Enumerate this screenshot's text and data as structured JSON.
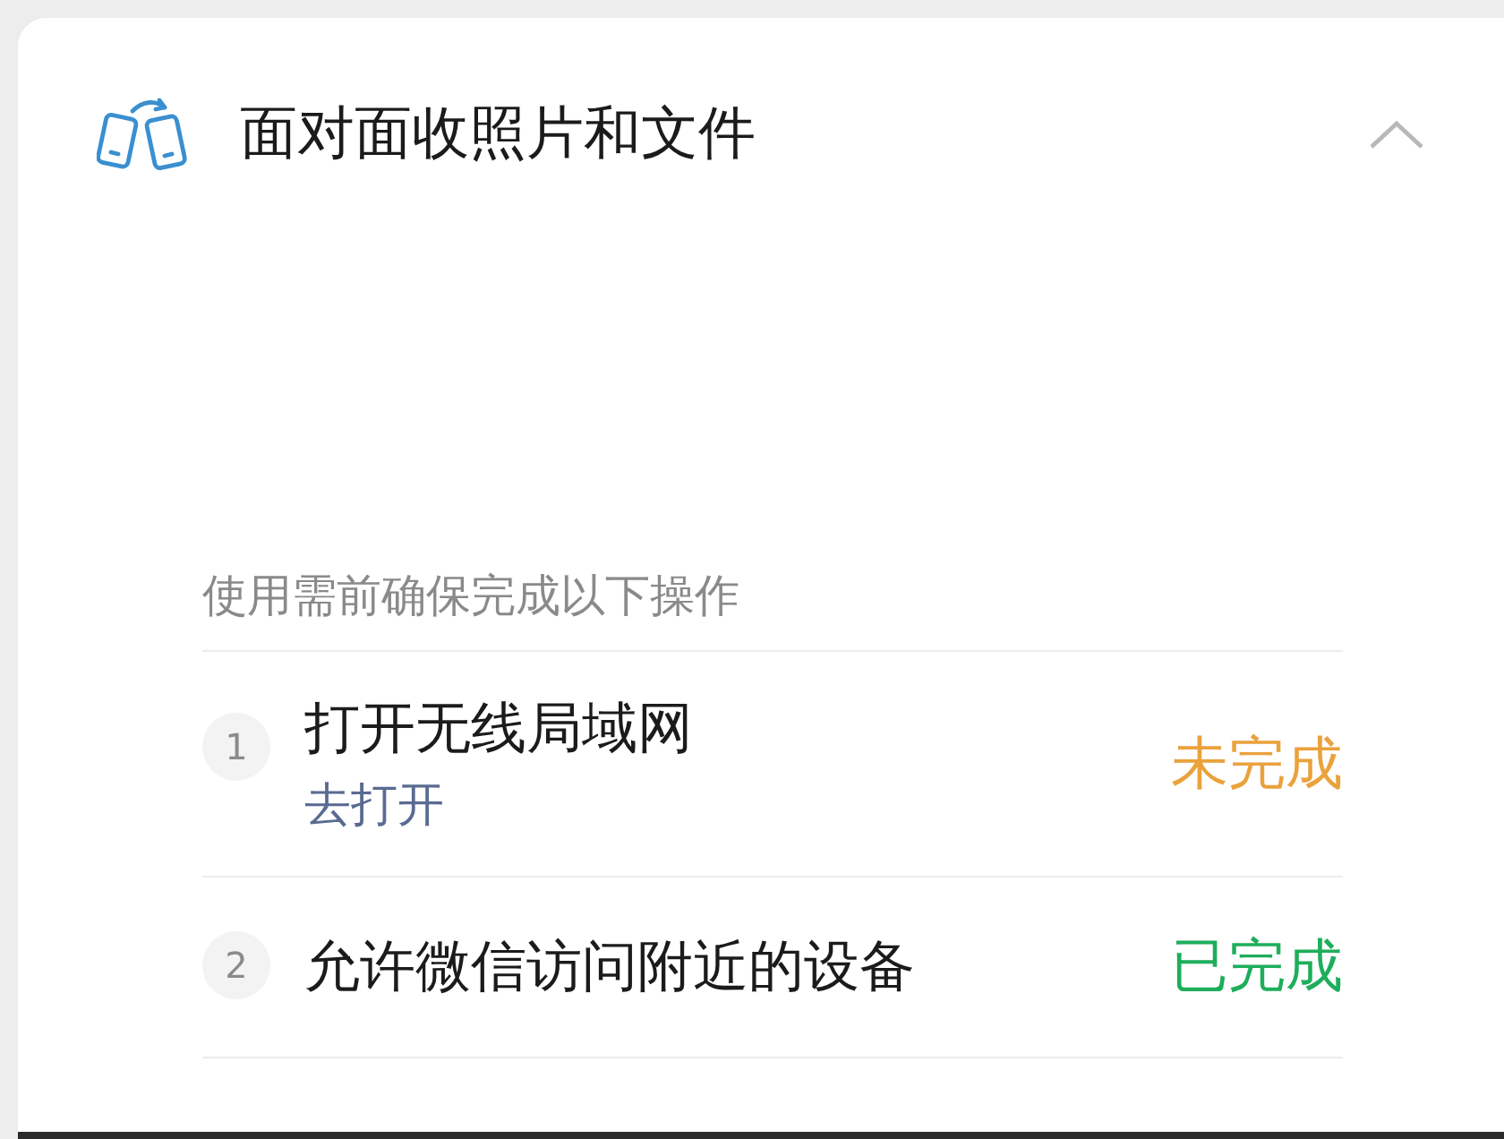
{
  "header": {
    "title": "面对面收照片和文件",
    "expanded": true
  },
  "section": {
    "caption": "使用需前确保完成以下操作",
    "steps": [
      {
        "number": "1",
        "title": "打开无线局域网",
        "link": "去打开",
        "status": "未完成",
        "done": false
      },
      {
        "number": "2",
        "title": "允许微信访问附近的设备",
        "status": "已完成",
        "done": true
      }
    ]
  }
}
